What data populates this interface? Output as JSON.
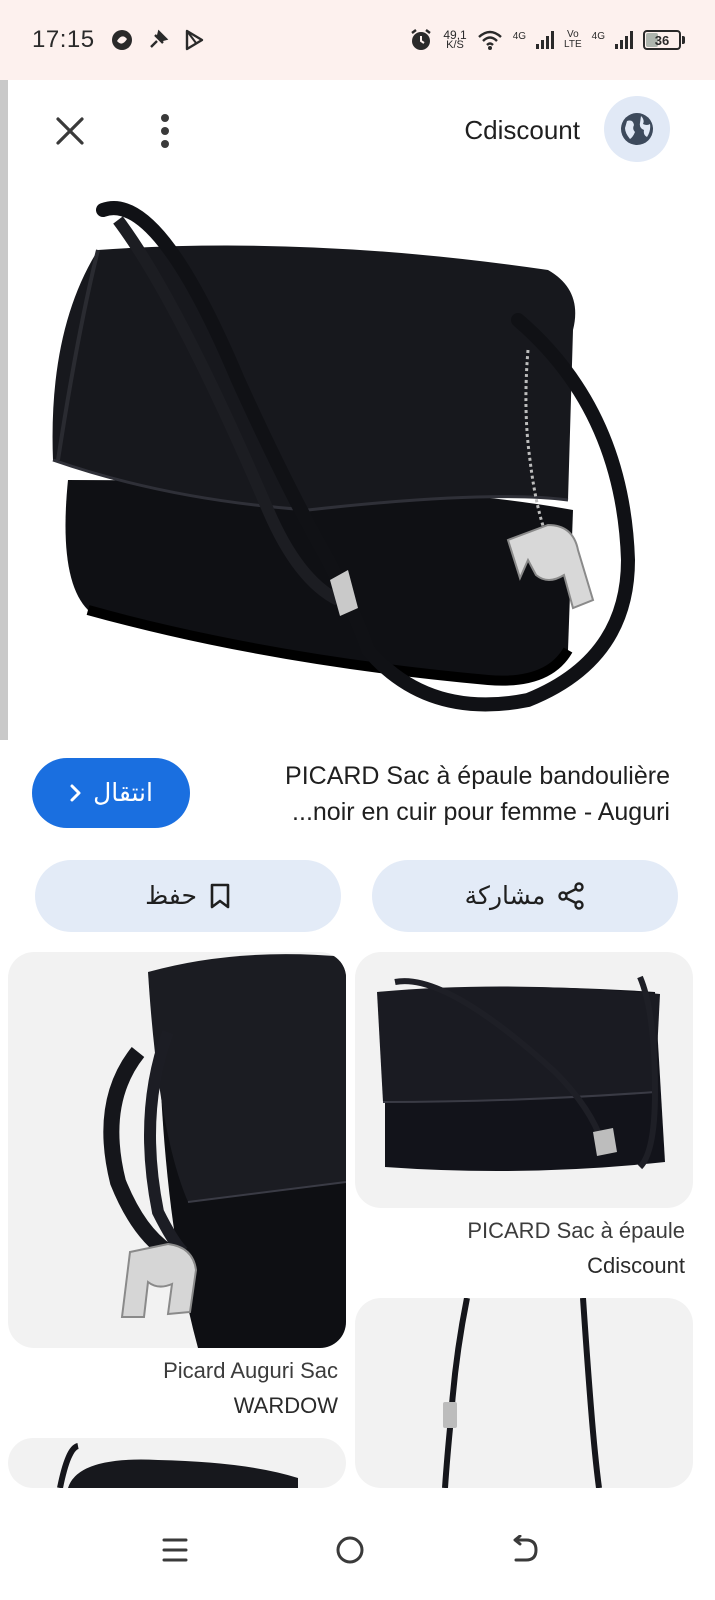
{
  "status_bar": {
    "time": "17:15",
    "speed_value": "49,1",
    "speed_unit": "K/S",
    "net1": "4G",
    "volte_top": "Vo",
    "volte_bottom": "LTE",
    "net2": "4G",
    "battery": "36",
    "battery_level": 0.36
  },
  "toolbar": {
    "close_icon": "close-icon",
    "more_icon": "more-vert-icon",
    "source": "Cdiscount",
    "globe_icon": "globe-icon"
  },
  "result": {
    "title_line1": "PICARD Sac à épaule bandoulière",
    "title_line2": "...noir en cuir pour femme - Auguri",
    "visit_label": "انتقال",
    "visit_icon": "chevron-right-icon"
  },
  "actions": {
    "share_label": "مشاركة",
    "share_icon": "share-icon",
    "save_label": "حفظ",
    "save_icon": "bookmark-icon"
  },
  "related": [
    {
      "title": "PICARD Sac à épaule",
      "source": "Cdiscount"
    },
    {
      "title": "Picard Auguri Sac",
      "source": "WARDOW"
    }
  ],
  "nav": {
    "menu_icon": "recents-icon",
    "home_icon": "home-icon",
    "back_icon": "back-icon"
  },
  "colors": {
    "accent": "#1a6fe0",
    "pill_bg": "#e3ebf7",
    "status_bg": "#fdf1ee"
  }
}
